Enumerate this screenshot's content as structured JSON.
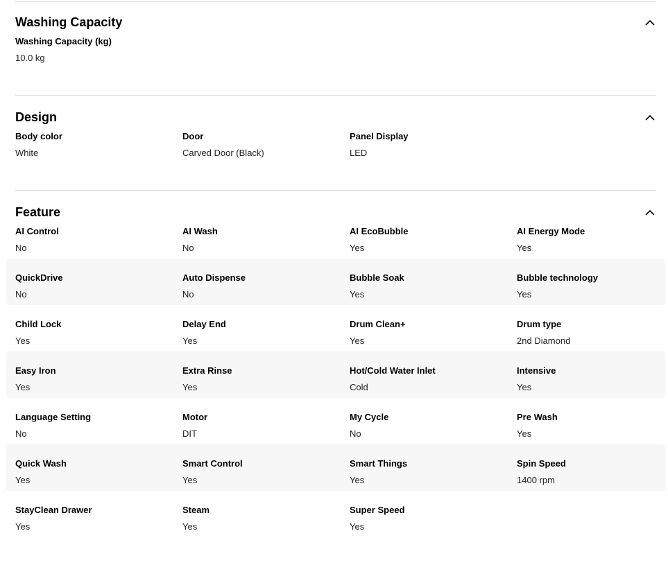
{
  "sections": [
    {
      "title": "Washing Capacity",
      "rows": [
        [
          {
            "label": "Washing Capacity (kg)",
            "value": "10.0 kg"
          }
        ]
      ]
    },
    {
      "title": "Design",
      "rows": [
        [
          {
            "label": "Body color",
            "value": "White"
          },
          {
            "label": "Door",
            "value": "Carved Door (Black)"
          },
          {
            "label": "Panel Display",
            "value": "LED"
          }
        ]
      ]
    },
    {
      "title": "Feature",
      "rows": [
        [
          {
            "label": "AI Control",
            "value": "No"
          },
          {
            "label": "AI Wash",
            "value": "No"
          },
          {
            "label": "AI EcoBubble",
            "value": "Yes"
          },
          {
            "label": "AI Energy Mode",
            "value": "Yes"
          }
        ],
        [
          {
            "label": "QuickDrive",
            "value": "No"
          },
          {
            "label": "Auto Dispense",
            "value": "No"
          },
          {
            "label": "Bubble Soak",
            "value": "Yes"
          },
          {
            "label": "Bubble technology",
            "value": "Yes"
          }
        ],
        [
          {
            "label": "Child Lock",
            "value": "Yes"
          },
          {
            "label": "Delay End",
            "value": "Yes"
          },
          {
            "label": "Drum Clean+",
            "value": "Yes"
          },
          {
            "label": "Drum type",
            "value": "2nd Diamond"
          }
        ],
        [
          {
            "label": "Easy Iron",
            "value": "Yes"
          },
          {
            "label": "Extra Rinse",
            "value": "Yes"
          },
          {
            "label": "Hot/Cold Water Inlet",
            "value": "Cold"
          },
          {
            "label": "Intensive",
            "value": "Yes"
          }
        ],
        [
          {
            "label": "Language Setting",
            "value": "No"
          },
          {
            "label": "Motor",
            "value": "DIT"
          },
          {
            "label": "My Cycle",
            "value": "No"
          },
          {
            "label": "Pre Wash",
            "value": "Yes"
          }
        ],
        [
          {
            "label": "Quick Wash",
            "value": "Yes"
          },
          {
            "label": "Smart Control",
            "value": "Yes"
          },
          {
            "label": "Smart Things",
            "value": "Yes"
          },
          {
            "label": "Spin Speed",
            "value": "1400 rpm"
          }
        ],
        [
          {
            "label": "StayClean Drawer",
            "value": "Yes"
          },
          {
            "label": "Steam",
            "value": "Yes"
          },
          {
            "label": "Super Speed",
            "value": "Yes"
          }
        ]
      ]
    }
  ],
  "icons": {
    "collapse": "chevron-up-icon"
  }
}
